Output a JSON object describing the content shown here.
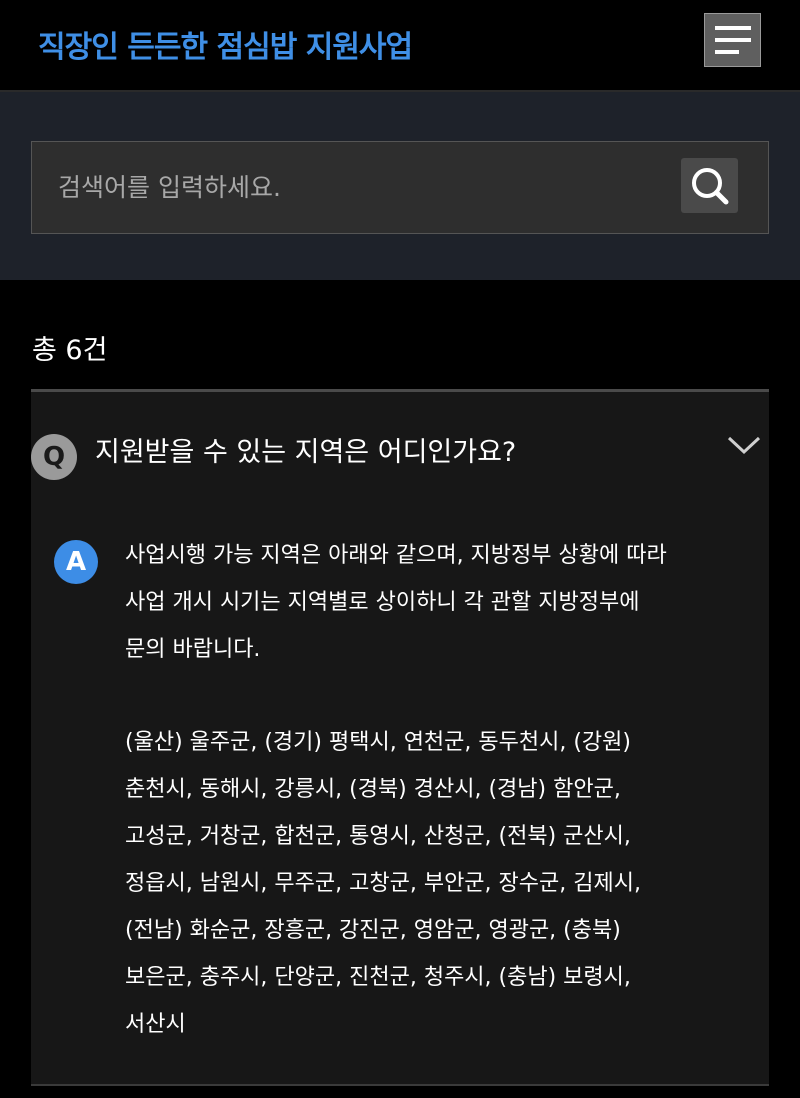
{
  "header": {
    "title": "직장인 든든한 점심밥 지원사업",
    "menu_icon": "hamburger-menu-icon"
  },
  "search": {
    "placeholder": "검색어를 입력하세요.",
    "value": "",
    "button_icon": "search-icon"
  },
  "results": {
    "count_label": "총 6건"
  },
  "faq": {
    "items": [
      {
        "q_badge": "Q",
        "question": "지원받을 수 있는 지역은 어디인가요?",
        "expand_icon": "chevron-down-icon",
        "a_badge": "A",
        "answer_intro_lines": [
          "사업시행 가능 지역은 아래와 같으며, 지방정부 상황에 따라",
          "사업 개시 시기는 지역별로 상이하니 각 관할 지방정부에",
          "문의 바랍니다."
        ],
        "answer_region_lines": [
          "(울산) 울주군, (경기) 평택시, 연천군, 동두천시, (강원)",
          "춘천시, 동해시, 강릉시, (경북) 경산시, (경남) 함안군,",
          "고성군, 거창군, 합천군, 통영시, 산청군, (전북) 군산시,",
          "정읍시, 남원시, 무주군, 고창군, 부안군, 장수군, 김제시,",
          "(전남) 화순군, 장흥군, 강진군, 영암군, 영광군, (충북)",
          "보은군, 충주시, 단양군, 진천군, 청주시, (충남) 보령시,",
          "서산시"
        ]
      }
    ]
  },
  "colors": {
    "accent_blue": "#3f8fe6",
    "search_band": "#1e222a",
    "card_bg": "#171717"
  }
}
